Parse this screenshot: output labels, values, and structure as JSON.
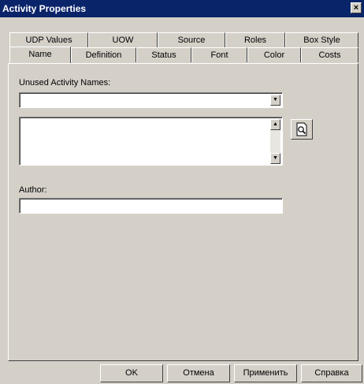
{
  "window": {
    "title": "Activity Properties",
    "close_glyph": "×"
  },
  "tabs_back": [
    "UDP Values",
    "UOW",
    "Source",
    "Roles",
    "Box Style"
  ],
  "tabs_front": [
    "Name",
    "Definition",
    "Status",
    "Font",
    "Color",
    "Costs"
  ],
  "active_tab": "Name",
  "name_tab": {
    "unused_names_label": "Unused Activity Names:",
    "unused_names_value": "",
    "names_list_items": [],
    "author_label": "Author:",
    "author_value": ""
  },
  "buttons": {
    "ok": "OK",
    "cancel": "Отмена",
    "apply": "Применить",
    "help": "Справка"
  },
  "icons": {
    "dropdown": "triangle-down",
    "scroll_up": "triangle-up",
    "scroll_down": "triangle-down",
    "preview": "magnifier-page"
  }
}
